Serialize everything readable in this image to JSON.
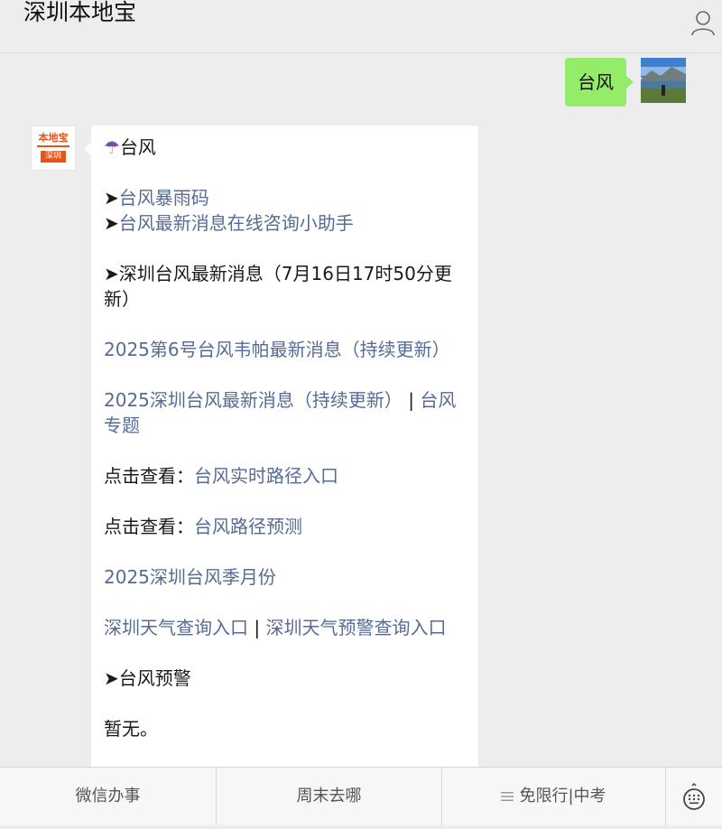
{
  "header": {
    "title": "深圳本地宝",
    "user_icon": "user-icon"
  },
  "outgoing": {
    "text": "台风",
    "avatar_icon": "user-photo-avatar"
  },
  "incoming": {
    "avatar_logo_top": "本地宝",
    "avatar_logo_city": "深圳",
    "lines": {
      "umbrella": "☂",
      "heading": "台风",
      "bullet": "➤",
      "link1": "台风暴雨码",
      "link2": "台风最新消息在线咨询小助手",
      "news_heading": "深圳台风最新消息（7月16日17时50分更新）",
      "link3": "2025第6号台风韦帕最新消息（持续更新）",
      "link4": "2025深圳台风最新消息（持续更新）",
      "separator": " | ",
      "link5": "台风专题",
      "click_view": "点击查看：",
      "link6": "台风实时路径入口",
      "link7": "台风路径预测",
      "link8": "2025深圳台风季月份",
      "link9": "深圳天气查询入口",
      "separator2": " | ",
      "link10": "深圳天气预警查询入口",
      "warning_heading": "台风预警",
      "none": "暂无。"
    }
  },
  "bottom_bar": {
    "tab1": "微信办事",
    "tab2": "周末去哪",
    "tab3": "免限行|中考",
    "keyboard_icon": "keyboard-icon"
  }
}
